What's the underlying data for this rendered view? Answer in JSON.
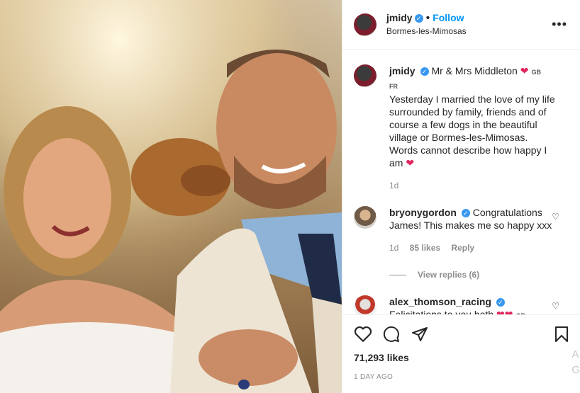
{
  "post": {
    "username": "jmidy",
    "follow_label": "Follow",
    "location": "Bormes-les-Mimosas",
    "more_label": "•••"
  },
  "caption": {
    "username": "jmidy",
    "title": "Mr & Mrs Middleton",
    "flags": [
      "GB",
      "FR"
    ],
    "text": "Yesterday I married the love of my life surrounded by family, friends and of course a few dogs in the beautiful village or Bormes-les-Mimosas. Words cannot describe how happy I am",
    "time": "1d"
  },
  "comments": [
    {
      "username": "bryonygordon",
      "text": "Congratulations James! This makes me so happy xxx",
      "time": "1d",
      "likes": "85 likes",
      "reply_label": "Reply",
      "view_replies": "View replies (6)"
    },
    {
      "username": "alex_thomson_racing",
      "text": "Felicitations to you both",
      "flag": "GB"
    }
  ],
  "actions": {
    "likes": "71,293 likes",
    "timestamp": "1 DAY AGO"
  },
  "edge_letters": [
    "A",
    "G"
  ]
}
